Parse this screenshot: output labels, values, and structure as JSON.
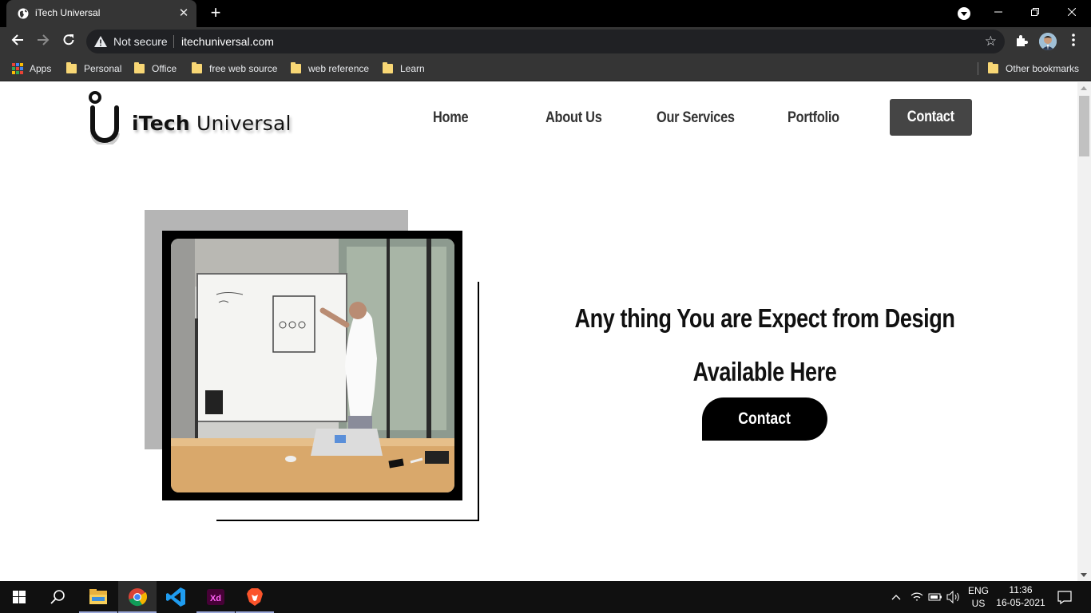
{
  "browser": {
    "tab_title": "iTech Universal",
    "tab_close": "✕",
    "new_tab": "+",
    "security_label": "Not secure",
    "url": "itechuniversal.com",
    "bookmarks": [
      "Apps",
      "Personal",
      "Office",
      "free web source",
      "web reference",
      "Learn"
    ],
    "other_bookmarks": "Other bookmarks"
  },
  "site": {
    "logo_prefix": "iTech",
    "logo_suffix": "Universal",
    "nav": [
      "Home",
      "About Us",
      "Our Services",
      "Portfolio"
    ],
    "nav_contact": "Contact",
    "headline_line1": "Any thing You are Expect from Design",
    "headline_line2": "Available Here",
    "cta": "Contact"
  },
  "taskbar": {
    "lang_line1": "ENG",
    "lang_line2": "US",
    "time": "11:36",
    "date": "16-05-2021"
  },
  "colors": {
    "nav_contact_bg": "#454545",
    "cta_bg": "#000000",
    "gray_block": "#b5b5b5"
  }
}
